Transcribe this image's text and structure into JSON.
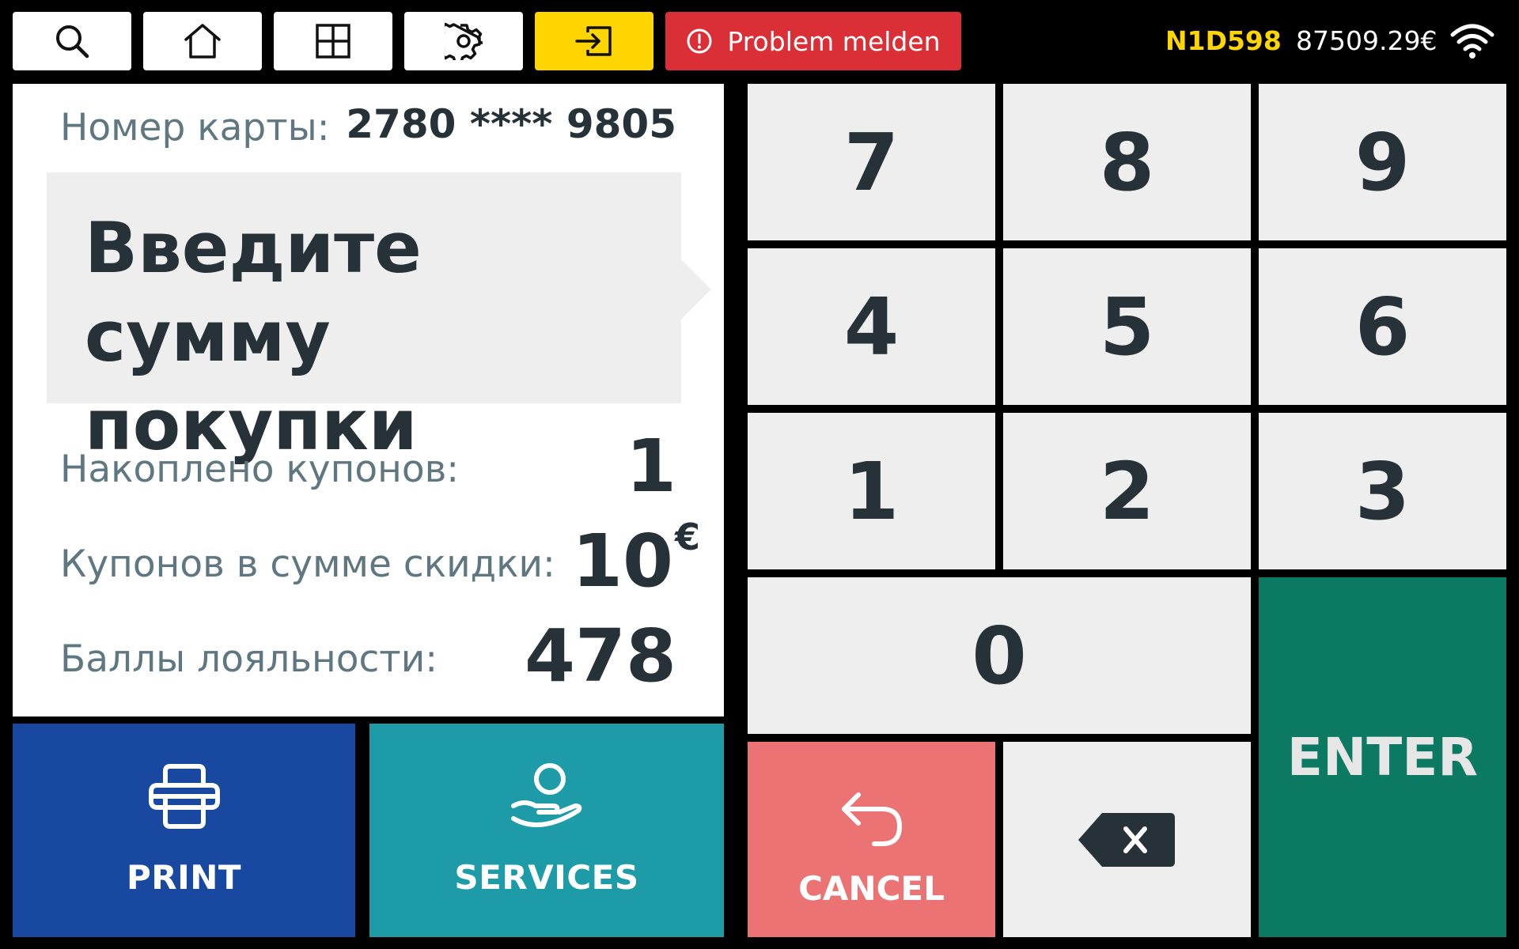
{
  "topbar": {
    "icons": [
      "search-icon",
      "home-icon",
      "grid-icon",
      "gear-icon",
      "sign-in-icon"
    ],
    "problem_label": "Problem melden",
    "problem_icon": "alert-circle-icon",
    "terminal_id": "N1D598",
    "balance": "87509.29€",
    "wifi_icon": "wifi-icon"
  },
  "card": {
    "label": "Номер карты:",
    "number": "2780 **** 9805"
  },
  "prompt": {
    "line1": "Введите сумму",
    "line2": "покупки"
  },
  "stats": {
    "coupons_label": "Накоплено купонов:",
    "coupons_value": "1",
    "discount_label": "Купонов в сумме скидки:",
    "discount_value": "10",
    "discount_currency": "€",
    "points_label": "Баллы лояльности:",
    "points_value": "478"
  },
  "actions": {
    "print_label": "PRINT",
    "services_label": "SERVICES"
  },
  "keypad": {
    "keys": [
      "7",
      "8",
      "9",
      "4",
      "5",
      "6",
      "1",
      "2",
      "3",
      "0"
    ],
    "enter_label": "ENTER",
    "cancel_label": "CANCEL"
  },
  "colors": {
    "accent_yellow": "#ffd500",
    "problem_red": "#da2f37",
    "print_blue": "#1848a0",
    "services_teal": "#1d9ca8",
    "enter_green": "#0c7a63",
    "cancel_salmon": "#eb7373"
  }
}
